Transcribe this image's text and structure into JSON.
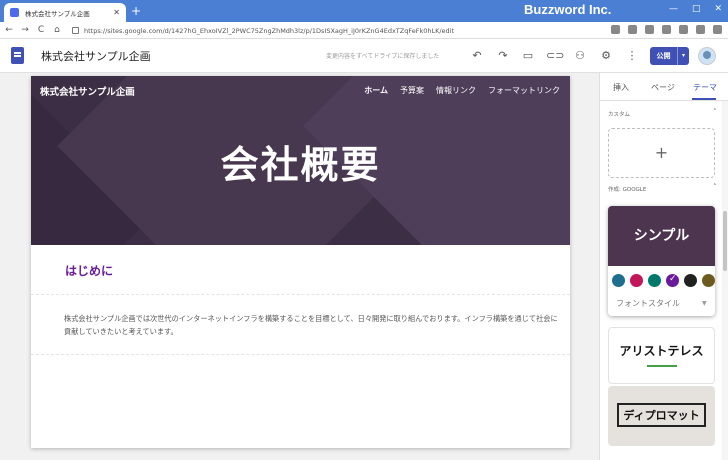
{
  "browser": {
    "tab_title": "株式会社サンプル企画",
    "tab_close": "✕",
    "new_tab": "+",
    "brand": "Buzzword Inc.",
    "window_buttons": [
      "—",
      "□",
      "✕"
    ],
    "nav_icons": [
      "←",
      "→",
      "C",
      "⌂"
    ],
    "url": "https://sites.google.com/d/1427hG_EhxoIVZl_2PWC75ZngZhMdh3lz/p/1DsISXagH_iJ0rKZnG4EdxTZqFeFk0hLK/edit"
  },
  "toolbar": {
    "site_name": "株式会社サンプル企画",
    "save_status": "変更内容をすべてドライブに保存しました",
    "undo": "↶",
    "redo": "↷",
    "publish_label": "公開",
    "publish_caret": "▾"
  },
  "page": {
    "site_title": "株式会社サンプル企画",
    "nav": [
      {
        "label": "ホーム"
      },
      {
        "label": "予算案"
      },
      {
        "label": "情報リンク"
      },
      {
        "label": "フォーマットリンク"
      }
    ],
    "hero_title": "会社概要",
    "intro_heading": "はじめに",
    "body_text": "株式会社サンプル企画では次世代のインターネットインフラを構築することを目標として、日々開発に取り組んでおります。インフラ構築を通じて社会に貢献していきたいと考えています。"
  },
  "panel": {
    "tabs": [
      "挿入",
      "ページ",
      "テーマ"
    ],
    "active_tab": "テーマ",
    "custom_label": "カスタム",
    "add_symbol": "+",
    "google_label": "作成: GOOGLE",
    "themes": {
      "simple": {
        "name": "シンプル",
        "font_style_label": "フォントスタイル",
        "swatch_colors": [
          "#1e6f8f",
          "#c2185b",
          "#00796b",
          "#6a1b9a",
          "#212121",
          "#6d5a1e"
        ],
        "selected_swatch": 3
      },
      "aristotle": {
        "name": "アリストテレス"
      },
      "diplomat": {
        "name": "ディプロマット"
      }
    }
  }
}
